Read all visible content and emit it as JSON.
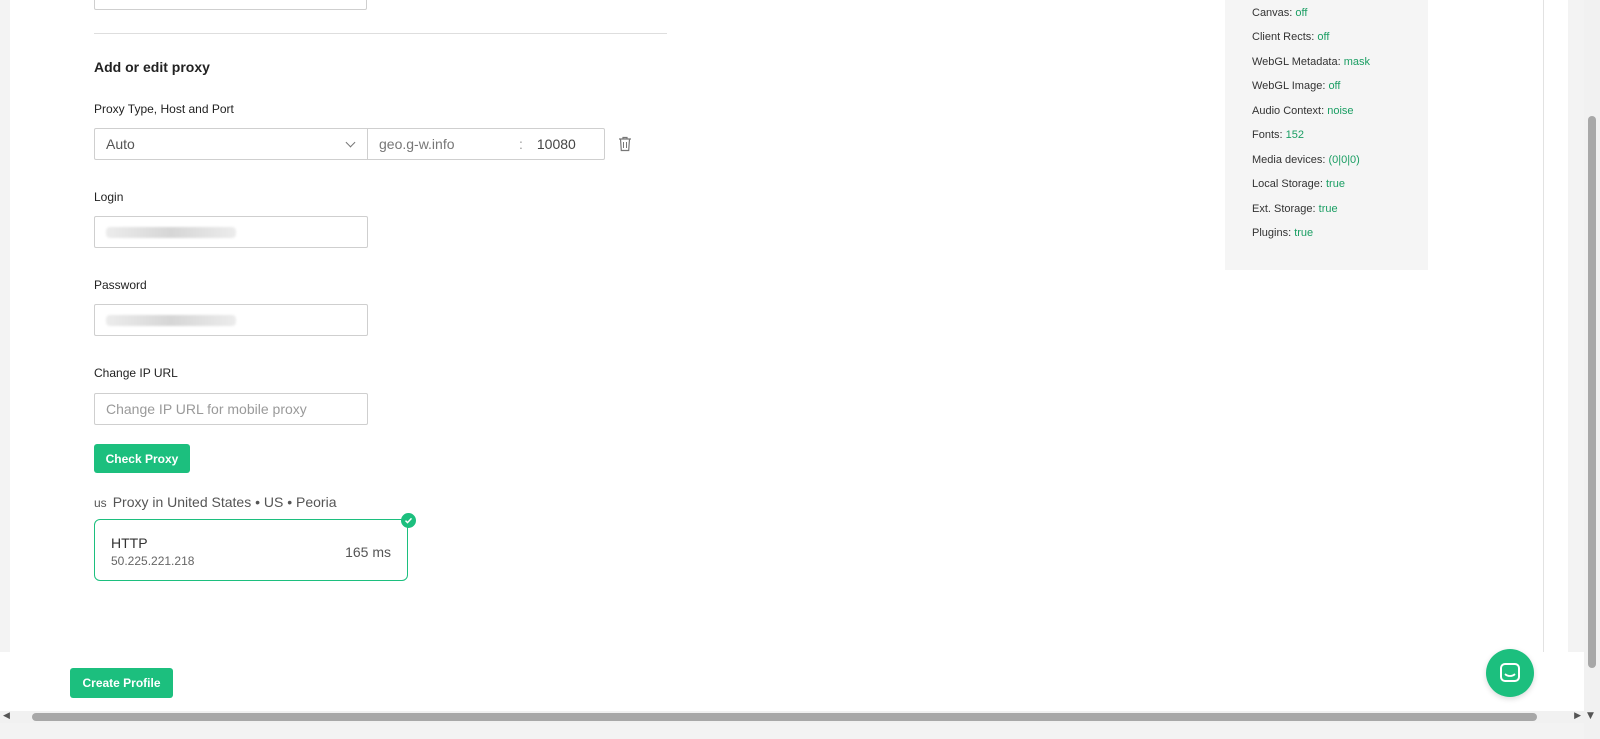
{
  "form": {
    "section_title": "Add or edit proxy",
    "proxy_type_label": "Proxy Type, Host and Port",
    "proxy_type_value": "Auto",
    "host_value": "geo.g-w.info",
    "port_separator": ":",
    "port_value": "10080",
    "login_label": "Login",
    "password_label": "Password",
    "change_ip_label": "Change IP URL",
    "change_ip_placeholder": "Change IP URL for mobile proxy",
    "check_button": "Check Proxy"
  },
  "proxy_result": {
    "country_code": "us",
    "location_text": "Proxy in United States • US • Peoria",
    "protocol": "HTTP",
    "ip": "50.225.221.218",
    "latency": "165 ms",
    "accent_color": "#1cbf7e"
  },
  "fingerprint": [
    {
      "key": "Canvas:",
      "value": "off"
    },
    {
      "key": "Client Rects:",
      "value": "off"
    },
    {
      "key": "WebGL Metadata:",
      "value": "mask"
    },
    {
      "key": "WebGL Image:",
      "value": "off"
    },
    {
      "key": "Audio Context:",
      "value": "noise"
    },
    {
      "key": "Fonts:",
      "value": "152"
    },
    {
      "key": "Media devices:",
      "value": "(0|0|0)"
    },
    {
      "key": "Local Storage:",
      "value": "true"
    },
    {
      "key": "Ext. Storage:",
      "value": "true"
    },
    {
      "key": "Plugins:",
      "value": "true"
    }
  ],
  "footer": {
    "create_button": "Create Profile",
    "chat_icon": "chat-icon"
  }
}
